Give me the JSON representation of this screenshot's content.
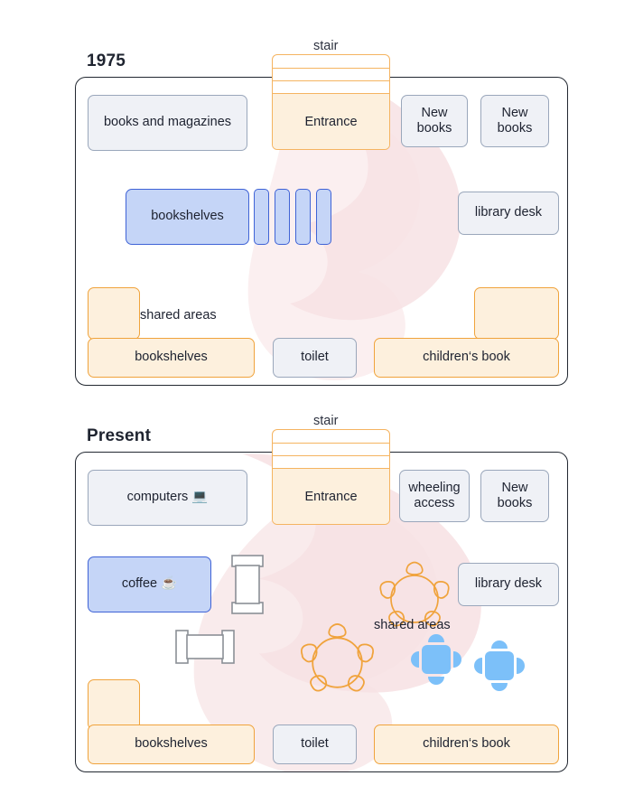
{
  "colors": {
    "gray_fill": "#eff1f6",
    "gray_stroke": "#9aa7bb",
    "blue_fill": "#c5d5f7",
    "blue_stroke": "#3f63d6",
    "orange_fill": "#fdf0dd",
    "orange_stroke": "#f0a33c",
    "chair_blue": "#7cc0f9",
    "watermark_pink": "#f7e2e4",
    "panel_border": "#222831",
    "text": "#1d2230"
  },
  "panels": [
    {
      "title": "1975",
      "stair_label": "stair",
      "entrance_label": "Entrance",
      "boxes": [
        {
          "name": "books-and-magazines",
          "label": "books and magazines",
          "style": "gray"
        },
        {
          "name": "new-books-1",
          "label": "New\nbooks",
          "style": "gray"
        },
        {
          "name": "new-books-2",
          "label": "New\nbooks",
          "style": "gray"
        },
        {
          "name": "bookshelves-main",
          "label": "bookshelves",
          "style": "blue"
        },
        {
          "name": "library-desk",
          "label": "library desk",
          "style": "gray"
        },
        {
          "name": "shared-area-left-upper",
          "label": "",
          "style": "orange"
        },
        {
          "name": "bookshelves-lower",
          "label": "bookshelves",
          "style": "orange"
        },
        {
          "name": "toilet",
          "label": "toilet",
          "style": "gray"
        },
        {
          "name": "shared-area-right-upper",
          "label": "",
          "style": "orange"
        },
        {
          "name": "childrens-book",
          "label": "children‘s book",
          "style": "orange"
        }
      ],
      "labels": [
        {
          "name": "shared-areas-label",
          "text": "shared areas"
        }
      ],
      "slat_count": 4
    },
    {
      "title": "Present",
      "stair_label": "stair",
      "entrance_label": "Entrance",
      "boxes": [
        {
          "name": "computers",
          "label": "computers 💻",
          "style": "gray"
        },
        {
          "name": "wheeling-access",
          "label": "wheeling\naccess",
          "style": "gray"
        },
        {
          "name": "new-books",
          "label": "New\nbooks",
          "style": "gray"
        },
        {
          "name": "coffee",
          "label": "coffee ☕",
          "style": "blue"
        },
        {
          "name": "library-desk",
          "label": "library desk",
          "style": "gray"
        },
        {
          "name": "shared-area-left-upper",
          "label": "",
          "style": "orange"
        },
        {
          "name": "bookshelves-lower",
          "label": "bookshelves",
          "style": "orange"
        },
        {
          "name": "toilet",
          "label": "toilet",
          "style": "gray"
        },
        {
          "name": "childrens-book",
          "label": "children‘s book",
          "style": "orange"
        }
      ],
      "labels": [
        {
          "name": "shared-areas-label",
          "text": "shared areas"
        }
      ],
      "round_tables": 2,
      "blue_tables": 2,
      "furniture_outlines": 2
    }
  ]
}
